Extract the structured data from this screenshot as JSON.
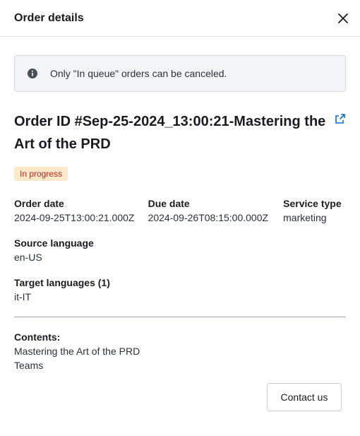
{
  "dialog": {
    "title": "Order details",
    "close_icon": "close-icon"
  },
  "info_banner": {
    "icon": "info-icon",
    "message": "Only \"In queue\" orders can be canceled."
  },
  "order": {
    "title": "Order ID #Sep-25-2024_13:00:21-Mastering the Art of the PRD",
    "external_link_icon": "external-link-icon",
    "status": "In progress",
    "status_color": "#b3261e",
    "status_bg": "#fde8c9"
  },
  "fields": {
    "order_date": {
      "label": "Order date",
      "value": "2024-09-25T13:00:21.000Z"
    },
    "due_date": {
      "label": "Due date",
      "value": "2024-09-26T08:15:00.000Z"
    },
    "service_type": {
      "label": "Service type",
      "value": "marketing"
    },
    "source_language": {
      "label": "Source language",
      "value": "en-US"
    },
    "target_languages": {
      "label": "Target languages (1)",
      "value": "it-IT"
    }
  },
  "contents": {
    "label": "Contents:",
    "items": [
      "Mastering the Art of the PRD",
      "Teams"
    ]
  },
  "footer": {
    "contact_label": "Contact us"
  }
}
